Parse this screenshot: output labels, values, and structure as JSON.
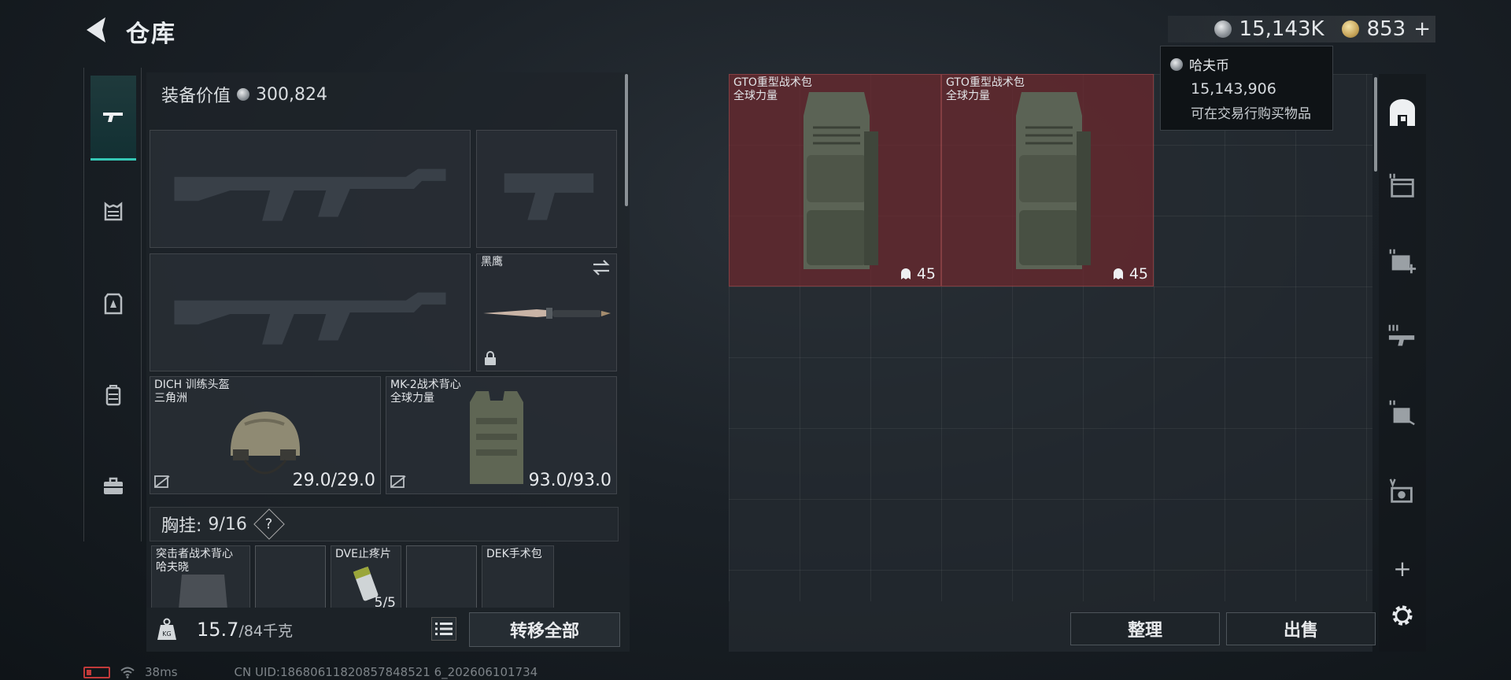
{
  "header": {
    "title": "仓库",
    "silver_amount": "15,143K",
    "gold_amount": "853",
    "gold_plus": "+"
  },
  "equipment": {
    "value_label": "装备价值",
    "value": "300,824",
    "melee": {
      "name": "黑鹰"
    },
    "helmet": {
      "name": "DICH 训练头盔",
      "brand": "三角洲",
      "durability": "29.0/29.0"
    },
    "vest": {
      "name": "MK-2战术背心",
      "brand": "全球力量",
      "durability": "93.0/93.0"
    },
    "chest": {
      "label": "胸挂:",
      "capacity": "9/16",
      "help": "?"
    },
    "chest_items": [
      {
        "name": "突击者战术背心",
        "brand": "哈夫晓"
      },
      {
        "name": "DVE止疼片",
        "count": "5/5"
      },
      {
        "name": "DEK手术包"
      }
    ],
    "weight_current": "15.7",
    "weight_max": "/84千克",
    "transfer_all": "转移全部"
  },
  "stash": {
    "items": [
      {
        "name": "GTO重型战术包",
        "brand": "全球力量",
        "count": "45"
      },
      {
        "name": "GTO重型战术包",
        "brand": "全球力量",
        "count": "45"
      }
    ],
    "organize": "整理",
    "sell": "出售",
    "add": "+"
  },
  "tooltip": {
    "title": "哈夫币",
    "value": "15,143,906",
    "desc": "可在交易行购买物品"
  },
  "status": {
    "ping": "38ms",
    "uid": "CN UID:18680611820857848521 6_202606101734"
  },
  "colors": {
    "accent": "#35c7b5",
    "stash_item_bg": "#6e282e",
    "battery": "#c23a3a"
  }
}
